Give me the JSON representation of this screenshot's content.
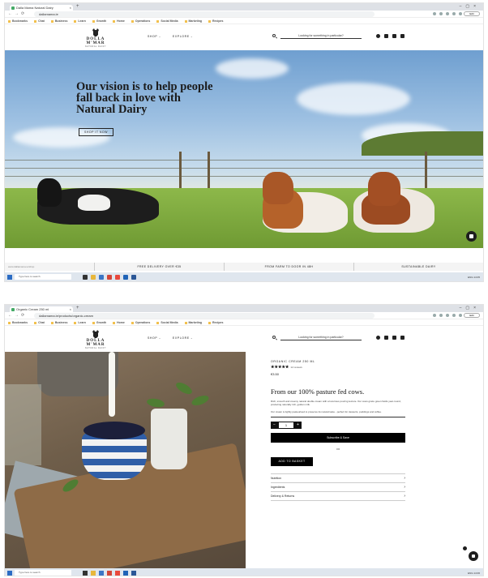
{
  "shot1": {
    "browser": {
      "tab_title": "Dalla Mama Natural Dairy",
      "url": "dallamama.ie",
      "profile": "Edit",
      "bookmarks": [
        "Bookmarks",
        "Chat",
        "Business",
        "Learn",
        "Growth",
        "Home",
        "Operations",
        "Social Media",
        "Marketing",
        "Recipes"
      ]
    },
    "header": {
      "brand": "DOLLA M'MAR",
      "brand_sub": "NATURAL DAIRY",
      "menu": [
        "SHOP",
        "EXPLORE"
      ],
      "search_placeholder": "Looking for something in particular?"
    },
    "hero": {
      "title": "Our vision is to help people fall back in love with Natural Dairy",
      "button": "SHOP IT NOW"
    },
    "strip": {
      "left": "www.dallamama.ie/shop",
      "items": [
        "FREE DELIVERY OVER €35",
        "FROM FARM TO DOOR IN 48H",
        "SUSTAINABLE DAIRY"
      ]
    },
    "taskbar": {
      "search": "Type here to search",
      "tray": "ENG 14:05"
    }
  },
  "shot2": {
    "browser": {
      "tab_title": "Organic Cream 250 ml",
      "url": "dallamama.ie/products/organic-cream",
      "profile": "Edit",
      "bookmarks": [
        "Bookmarks",
        "Chat",
        "Business",
        "Learn",
        "Growth",
        "Home",
        "Operations",
        "Social Media",
        "Marketing",
        "Recipes"
      ]
    },
    "header": {
      "brand": "DOLLA M'MAR",
      "brand_sub": "NATURAL DAIRY",
      "menu": [
        "SHOP",
        "EXPLORE"
      ],
      "search_placeholder": "Looking for something in particular?"
    },
    "product": {
      "title": "ORGANIC CREAM 250 ML",
      "stars": "★★★★★",
      "reviews": "12 reviews",
      "price": "€3.50",
      "headline": "From our 100% pasture fed cows.",
      "para1": "Rich, smooth and creamy natural double cream with a luxurious pouring texture. Our cows graze green fields year-round, producing naturally rich, golden milk.",
      "para2": "Our cream is lightly pasteurised to preserve its natural taste - perfect for desserts, puddings and coffee.",
      "qty_minus": "−",
      "qty_value": "1",
      "qty_plus": "+",
      "subscribe": "Subscribe & Save",
      "or": "OR",
      "add_to_basket": "ADD TO BASKET",
      "accordion": [
        "Nutrition",
        "Ingredients",
        "Delivery & Returns"
      ]
    },
    "taskbar": {
      "search": "Type here to search",
      "tray": "ENG 14:06"
    }
  },
  "colors": {
    "accent": "#000000",
    "sky": "#9dc0e2",
    "grass": "#7ea63c",
    "bowl_blue": "#2f5ea8"
  }
}
